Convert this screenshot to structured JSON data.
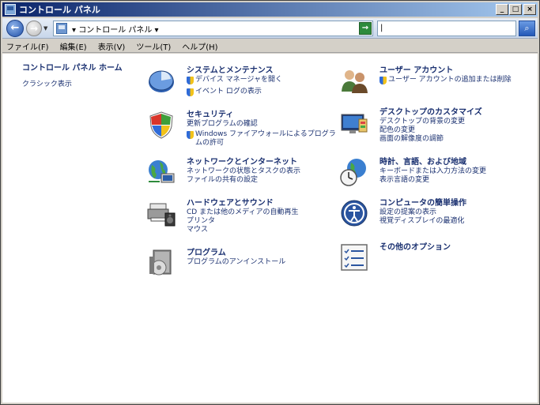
{
  "window": {
    "title": "コントロール パネル",
    "buttons": {
      "minimize": "_",
      "maximize": "□",
      "close": "×"
    }
  },
  "address": {
    "crumb": "▾ コントロール パネル ▾",
    "go_icon": "go-arrow-icon",
    "search_value": "|"
  },
  "menu": [
    {
      "label": "ファイル(F)"
    },
    {
      "label": "編集(E)"
    },
    {
      "label": "表示(V)"
    },
    {
      "label": "ツール(T)"
    },
    {
      "label": "ヘルプ(H)"
    }
  ],
  "sidebar": {
    "home": "コントロール パネル ホーム",
    "classic": "クラシック表示"
  },
  "categories": [
    {
      "title": "システムとメンテナンス",
      "icon": "system-maintenance-icon",
      "links": [
        {
          "label": "デバイス マネージャを開く",
          "shield": true
        },
        {
          "label": "イベント ログの表示",
          "shield": true
        }
      ]
    },
    {
      "title": "ユーザー アカウント",
      "icon": "user-accounts-icon",
      "links": [
        {
          "label": "ユーザー アカウントの追加または削除",
          "shield": true
        }
      ]
    },
    {
      "title": "セキュリティ",
      "icon": "security-shield-icon",
      "links": [
        {
          "label": "更新プログラムの確認",
          "shield": false
        },
        {
          "label": "Windows ファイアウォールによるプログラムの許可",
          "shield": true
        }
      ]
    },
    {
      "title": "デスクトップのカスタマイズ",
      "icon": "desktop-customize-icon",
      "links": [
        {
          "label": "デスクトップの背景の変更",
          "shield": false
        },
        {
          "label": "配色の変更",
          "shield": false
        },
        {
          "label": "画面の解像度の調節",
          "shield": false
        }
      ]
    },
    {
      "title": "ネットワークとインターネット",
      "icon": "network-internet-icon",
      "links": [
        {
          "label": "ネットワークの状態とタスクの表示",
          "shield": false
        },
        {
          "label": "ファイルの共有の設定",
          "shield": false
        }
      ]
    },
    {
      "title": "時計、言語、および地域",
      "icon": "clock-language-region-icon",
      "links": [
        {
          "label": "キーボードまたは入力方法の変更",
          "shield": false
        },
        {
          "label": "表示言語の変更",
          "shield": false
        }
      ]
    },
    {
      "title": "ハードウェアとサウンド",
      "icon": "hardware-sound-icon",
      "links": [
        {
          "label": "CD または他のメディアの自動再生",
          "shield": false
        },
        {
          "label": "プリンタ",
          "shield": false
        },
        {
          "label": "マウス",
          "shield": false
        }
      ]
    },
    {
      "title": "コンピュータの簡単操作",
      "icon": "ease-of-access-icon",
      "links": [
        {
          "label": "設定の提案の表示",
          "shield": false
        },
        {
          "label": "視覚ディスプレイの最適化",
          "shield": false
        }
      ]
    },
    {
      "title": "プログラム",
      "icon": "programs-icon",
      "links": [
        {
          "label": "プログラムのアンインストール",
          "shield": false
        }
      ]
    },
    {
      "title": "その他のオプション",
      "icon": "additional-options-icon",
      "links": []
    }
  ]
}
